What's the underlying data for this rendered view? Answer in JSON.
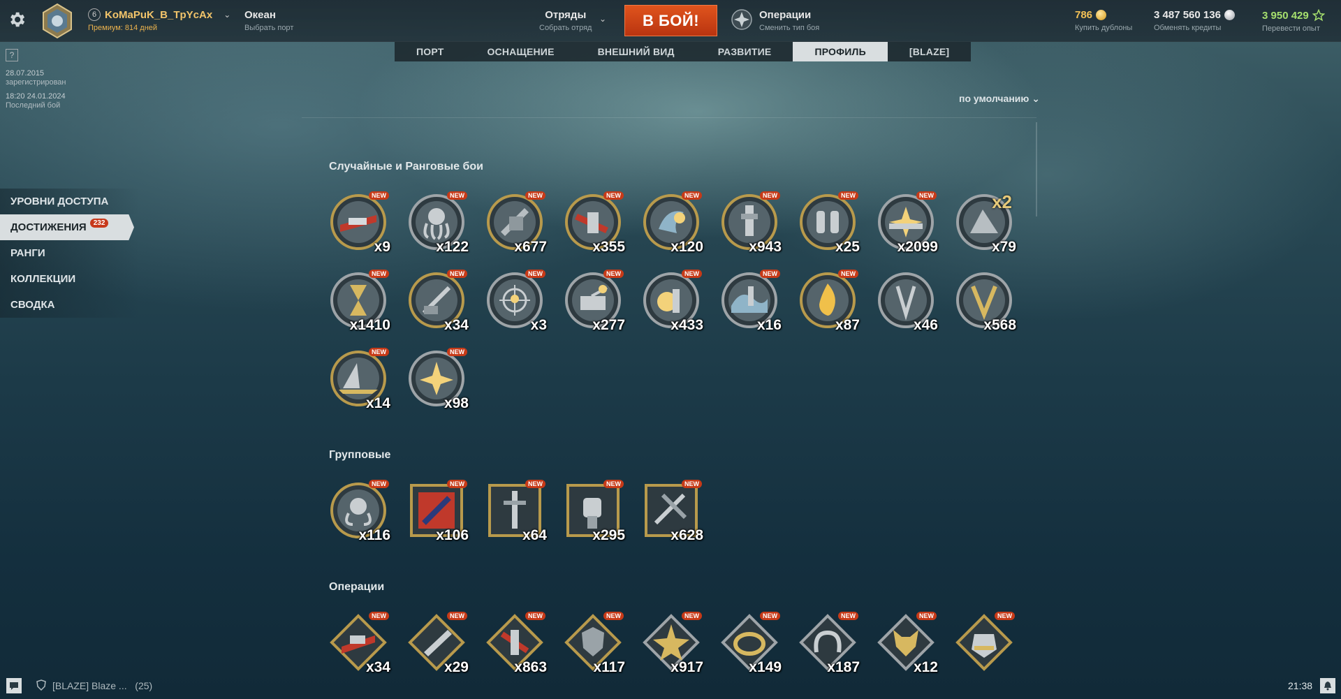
{
  "topbar": {
    "player": {
      "level_badge": "6",
      "name": "KoMaPuK_B_TpYcAx",
      "premium": "Премиум: 814 дней"
    },
    "port": {
      "title": "Океан",
      "subtitle": "Выбрать порт"
    },
    "squads": {
      "title": "Отряды",
      "subtitle": "Собрать отряд"
    },
    "battle_button": "В БОЙ!",
    "operations": {
      "title": "Операции",
      "subtitle": "Сменить тип боя"
    },
    "doubloons": {
      "value": "786",
      "action": "Купить дублоны"
    },
    "credits": {
      "value": "3 487 560 136",
      "action": "Обменять кредиты"
    },
    "free_xp": {
      "value": "3 950 429",
      "action": "Перевести опыт"
    }
  },
  "tabs": [
    "ПОРТ",
    "ОСНАЩЕНИЕ",
    "ВНЕШНИЙ ВИД",
    "РАЗВИТИЕ",
    "ПРОФИЛЬ",
    "[BLAZE]"
  ],
  "active_tab": "ПРОФИЛЬ",
  "account_info": {
    "help": "?",
    "registered_date": "28.07.2015",
    "registered_label": "зарегистрирован",
    "last_battle_date": "18:20  24.01.2024",
    "last_battle_label": "Последний бой"
  },
  "sidebar": {
    "items": [
      {
        "label": "УРОВНИ ДОСТУПА"
      },
      {
        "label": "ДОСТИЖЕНИЯ",
        "badge": "232"
      },
      {
        "label": "РАНГИ"
      },
      {
        "label": "КОЛЛЕКЦИИ"
      },
      {
        "label": "СВОДКА"
      }
    ]
  },
  "sort_label": "по умолчанию",
  "new_label": "NEW",
  "sections": {
    "random": {
      "title": "Случайные и Ранговые бои",
      "counts": [
        "x9",
        "x122",
        "x677",
        "x355",
        "x120",
        "x943",
        "x25",
        "x2099",
        "x79",
        "x1410",
        "x34",
        "x3",
        "x277",
        "x433",
        "x16",
        "x87",
        "x46",
        "x568",
        "x14",
        "x98"
      ],
      "x2_mark": "x2"
    },
    "group": {
      "title": "Групповые",
      "counts": [
        "x116",
        "x106",
        "x64",
        "x295",
        "x628"
      ]
    },
    "operations": {
      "title": "Операции",
      "counts": [
        "x34",
        "x29",
        "x863",
        "x117",
        "x917",
        "x149",
        "x187",
        "x12"
      ]
    }
  },
  "bottom": {
    "clan_chat": "[BLAZE] Blaze ...",
    "clan_count": "(25)",
    "clock": "21:38"
  }
}
